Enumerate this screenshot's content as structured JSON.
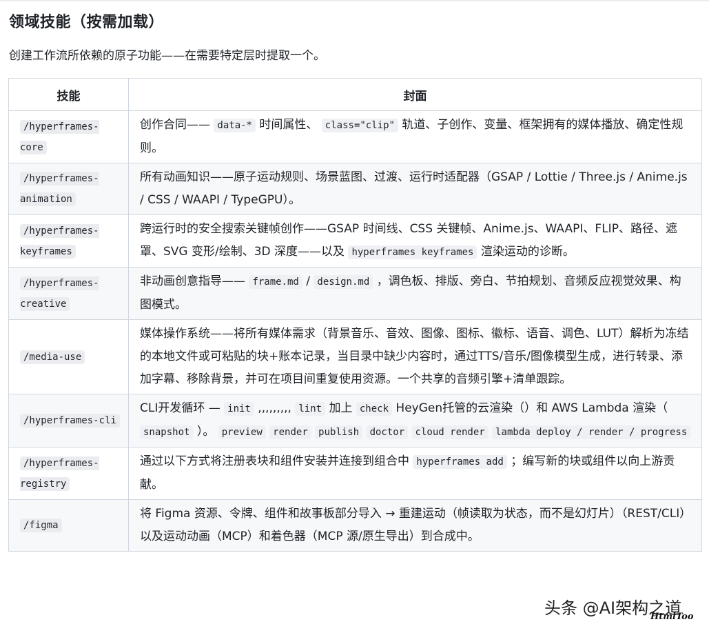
{
  "heading": "领域技能（按需加载）",
  "intro": "创建工作流所依赖的原子功能——在需要特定层时提取一个。",
  "table": {
    "headers": [
      "技能",
      "封面"
    ],
    "rows": [
      {
        "skill": "/hyperframes-core",
        "cover": [
          {
            "t": "创作合同—— "
          },
          {
            "c": "data-*"
          },
          {
            "t": " 时间属性、 "
          },
          {
            "c": "class=\"clip\""
          },
          {
            "t": " 轨道、子创作、变量、框架拥有的媒体播放、确定性规则。"
          }
        ]
      },
      {
        "skill": "/hyperframes-animation",
        "cover": [
          {
            "t": "所有动画知识——原子运动规则、场景蓝图、过渡、运行时适配器（GSAP / Lottie / Three.js / Anime.js / CSS / WAAPI / TypeGPU）。"
          }
        ]
      },
      {
        "skill": "/hyperframes-keyframes",
        "cover": [
          {
            "t": "跨运行时的安全搜索关键帧创作——GSAP 时间线、CSS 关键帧、Anime.js、WAAPI、FLIP、路径、遮罩、SVG 变形/绘制、3D 深度——以及 "
          },
          {
            "c": "hyperframes keyframes"
          },
          {
            "t": " 渲染运动的诊断。"
          }
        ]
      },
      {
        "skill": "/hyperframes-creative",
        "cover": [
          {
            "t": "非动画创意指导—— "
          },
          {
            "c": "frame.md"
          },
          {
            "t": " / "
          },
          {
            "c": "design.md"
          },
          {
            "t": " ，调色板、排版、旁白、节拍规划、音频反应视觉效果、构图模式。"
          }
        ]
      },
      {
        "skill": "/media-use",
        "cover": [
          {
            "t": "媒体操作系统——将所有媒体需求（背景音乐、音效、图像、图标、徽标、语音、调色、LUT）解析为冻结的本地文件或可粘贴的块+账本记录，当目录中缺少内容时，通过TTS/音乐/图像模型生成，进行转录、添加字幕、移除背景，并可在项目间重复使用资源。一个共享的音频引擎+清单跟踪。"
          }
        ]
      },
      {
        "skill": "/hyperframes-cli",
        "cover": [
          {
            "t": "CLI开发循环 — "
          },
          {
            "c": "init"
          },
          {
            "t": " ,,,,,,,,, "
          },
          {
            "c": "lint"
          },
          {
            "t": " 加上 "
          },
          {
            "c": "check"
          },
          {
            "t": " HeyGen托管的云渲染（）和 AWS Lambda 渲染（ "
          },
          {
            "c": "snapshot"
          },
          {
            "t": " ）。 "
          },
          {
            "c": "preview"
          },
          {
            "t": " "
          },
          {
            "c": "render"
          },
          {
            "t": " "
          },
          {
            "c": "publish"
          },
          {
            "t": " "
          },
          {
            "c": "doctor"
          },
          {
            "t": " "
          },
          {
            "c": "cloud render"
          },
          {
            "t": " "
          },
          {
            "c": "lambda deploy / render / progress"
          }
        ]
      },
      {
        "skill": "/hyperframes-registry",
        "cover": [
          {
            "t": "通过以下方式将注册表块和组件安装并连接到组合中 "
          },
          {
            "c": "hyperframes add"
          },
          {
            "t": " ；编写新的块或组件以向上游贡献。"
          }
        ]
      },
      {
        "skill": "/figma",
        "cover": [
          {
            "t": "将 Figma 资源、令牌、组件和故事板部分导入 → 重建运动（帧读取为状态，而不是幻灯片）（REST/CLI）以及运动动画（MCP）和着色器（MCP 源/原生导出）到合成中。"
          }
        ]
      }
    ]
  },
  "watermark": {
    "text": "头条 @AI架构之道",
    "brand": "HtmlToo"
  }
}
